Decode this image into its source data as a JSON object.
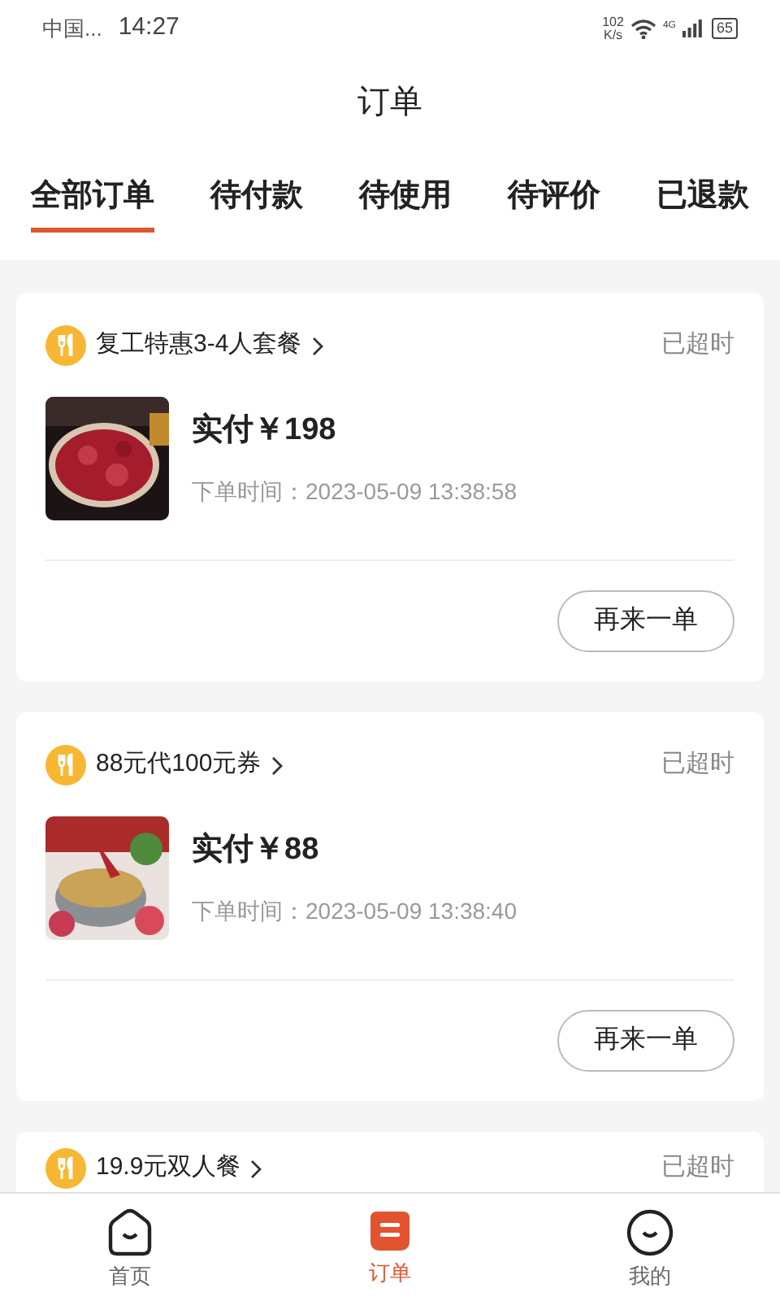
{
  "status_bar": {
    "carrier": "中国...",
    "time": "14:27",
    "speed_value": "102",
    "speed_unit": "K/s",
    "network": "4G",
    "battery": "65"
  },
  "header": {
    "title": "订单"
  },
  "tabs": [
    {
      "label": "全部订单",
      "selected": true
    },
    {
      "label": "待付款",
      "selected": false
    },
    {
      "label": "待使用",
      "selected": false
    },
    {
      "label": "待评价",
      "selected": false
    },
    {
      "label": "已退款",
      "selected": false
    }
  ],
  "orders": [
    {
      "name": "复工特惠3-4人套餐",
      "status": "已超时",
      "price": "实付￥198",
      "time": "下单时间：2023-05-09 13:38:58",
      "button": "再来一单"
    },
    {
      "name": "88元代100元券",
      "status": "已超时",
      "price": "实付￥88",
      "time": "下单时间：2023-05-09 13:38:40",
      "button": "再来一单"
    },
    {
      "name": "19.9元双人餐",
      "status": "已超时"
    }
  ],
  "nav": [
    {
      "label": "首页",
      "selected": false
    },
    {
      "label": "订单",
      "selected": true
    },
    {
      "label": "我的",
      "selected": false
    }
  ]
}
